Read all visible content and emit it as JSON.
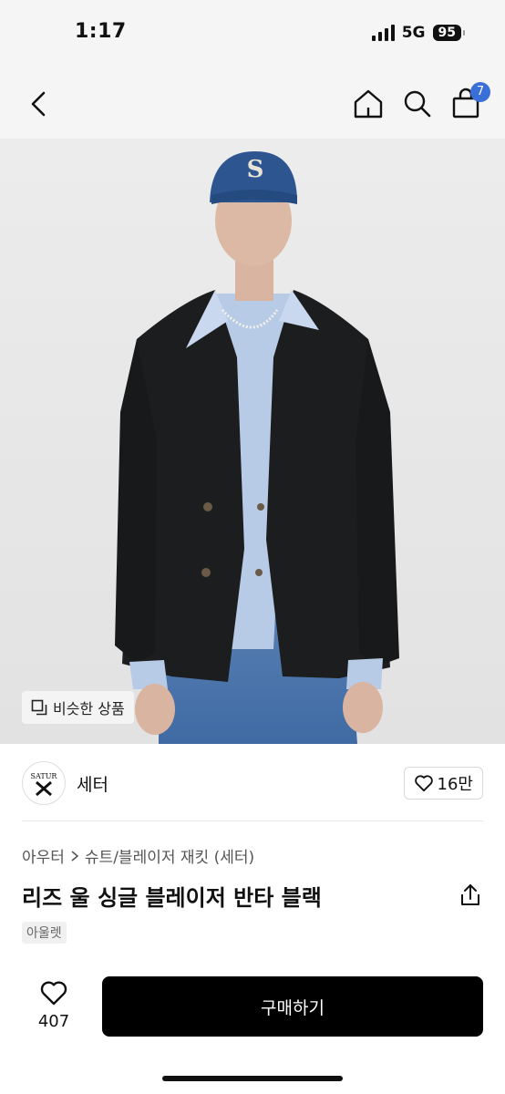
{
  "status_bar": {
    "time": "1:17",
    "network": "5G",
    "battery": "95"
  },
  "nav": {
    "cart_count": "7"
  },
  "product": {
    "similar_label": "비슷한 상품",
    "seller_name": "세터",
    "seller_logo_text": "SATUR",
    "favorites_count": "16만",
    "breadcrumb": {
      "category": "아우터",
      "subcategory": "슈트/블레이저 재킷 (세터)"
    },
    "title": "리즈 울 싱글 블레이저 반타 블랙",
    "tag": "아울렛",
    "image_cap_letter": "S"
  },
  "actions": {
    "like_count": "407",
    "buy_label": "구매하기"
  },
  "colors": {
    "accent": "#3b6fd8",
    "primary_button": "#000000",
    "background": "#ffffff"
  }
}
